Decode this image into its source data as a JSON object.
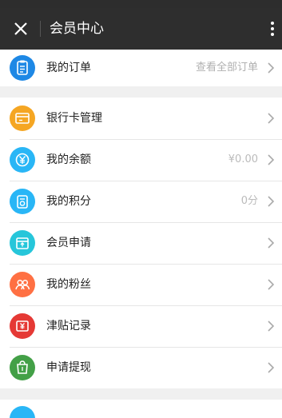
{
  "header": {
    "title": "会员中心"
  },
  "order": {
    "label": "我的订单",
    "link": "查看全部订单",
    "icon": "clipboard-icon",
    "color": "#1e88e5"
  },
  "menu": [
    {
      "label": "银行卡管理",
      "value": "",
      "icon": "bank-card-icon",
      "color": "#f5a623"
    },
    {
      "label": "我的余额",
      "value": "¥0.00",
      "icon": "yuan-coin-icon",
      "color": "#29b6f6"
    },
    {
      "label": "我的积分",
      "value": "0分",
      "icon": "points-icon",
      "color": "#29b6f6"
    },
    {
      "label": "会员申请",
      "value": "",
      "icon": "member-apply-icon",
      "color": "#26c6da"
    },
    {
      "label": "我的粉丝",
      "value": "",
      "icon": "fans-icon",
      "color": "#ff7043"
    },
    {
      "label": "津贴记录",
      "value": "",
      "icon": "allowance-icon",
      "color": "#e53935"
    },
    {
      "label": "申请提现",
      "value": "",
      "icon": "withdraw-icon",
      "color": "#43a047"
    }
  ],
  "colors": {
    "header_bg": "#2e2e2e",
    "page_bg": "#f0f0f0"
  }
}
